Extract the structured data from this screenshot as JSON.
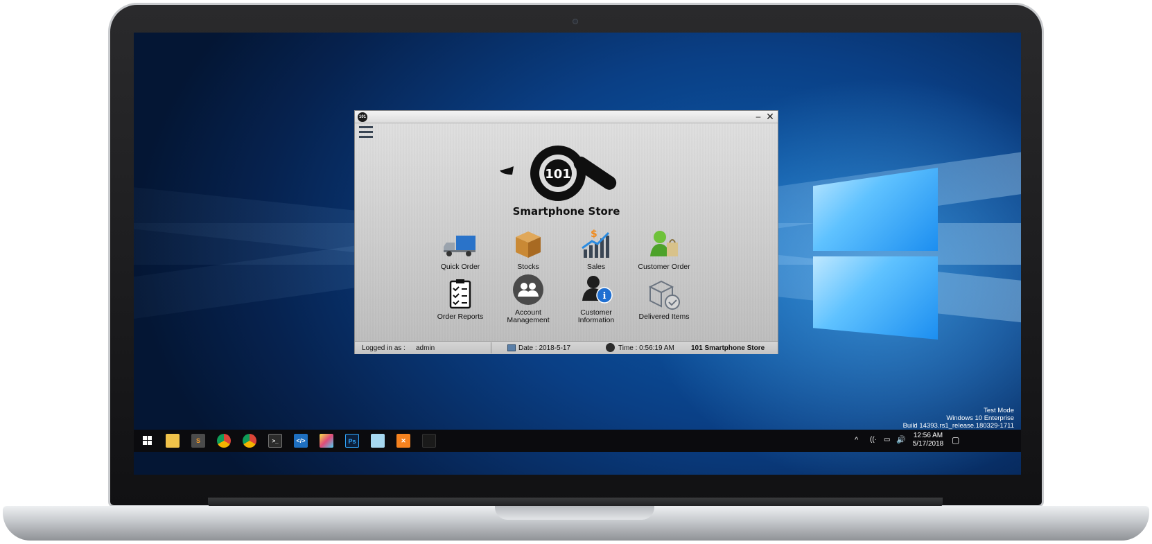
{
  "app": {
    "logo_name": "Smartphone Store",
    "logo_mark": "101",
    "tiles": [
      {
        "label": "Quick Order",
        "icon": "truck-icon"
      },
      {
        "label": "Stocks",
        "icon": "box-icon"
      },
      {
        "label": "Sales",
        "icon": "sales-chart-icon"
      },
      {
        "label": "Customer Order",
        "icon": "customer-shopping-icon"
      },
      {
        "label": "Order Reports",
        "icon": "clipboard-icon"
      },
      {
        "label": "Account\nManagement",
        "icon": "users-icon"
      },
      {
        "label": "Customer\nInformation",
        "icon": "user-info-icon"
      },
      {
        "label": "Delivered Items",
        "icon": "delivered-box-icon"
      }
    ],
    "status": {
      "logged_in_label": "Logged in as :",
      "user": "admin",
      "date": "Date : 2018-5-17",
      "time": "Time : 0:56:19 AM",
      "store": "101 Smartphone Store"
    },
    "controls": {
      "minimize": "–",
      "close": "✕"
    }
  },
  "os": {
    "watermark": [
      "Test Mode",
      "Windows 10 Enterprise",
      "Build 14393.rs1_release.180329-1711"
    ],
    "clock_time": "12:56 AM",
    "clock_date": "5/17/2018",
    "taskbar_apps": [
      "file-explorer-icon",
      "sublime-text-icon",
      "chrome-icon",
      "chrome-icon",
      "terminal-icon",
      "vscode-icon",
      "paint-icon",
      "photoshop-icon",
      "notepad-icon",
      "xampp-icon",
      "app-icon"
    ],
    "colors": {
      "desktop": "#0a3f85",
      "taskbar": "#0b0b0e",
      "window": "#cfcfcf"
    }
  }
}
